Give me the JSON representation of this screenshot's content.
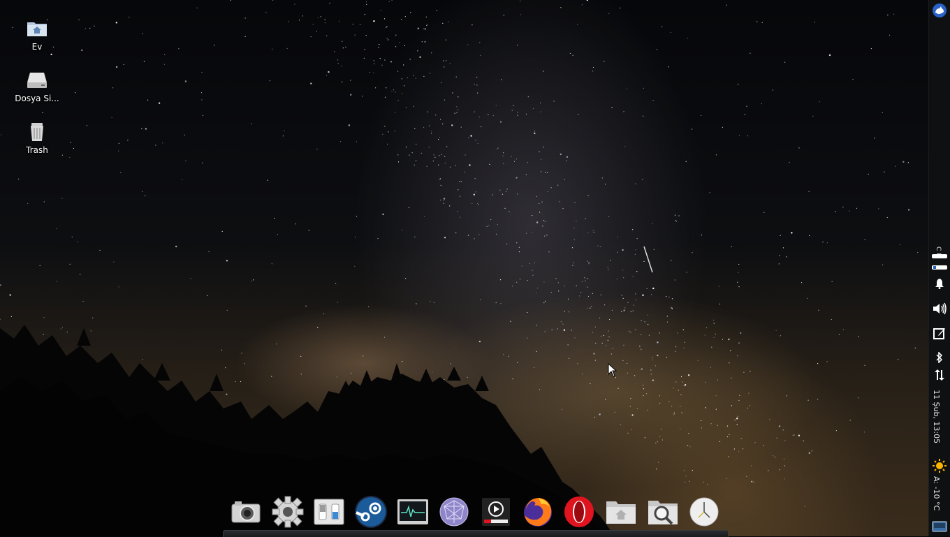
{
  "desktop": {
    "icons": [
      {
        "label": "Ev",
        "icon": "home-folder-icon"
      },
      {
        "label": "Dosya Si...",
        "icon": "drive-icon"
      },
      {
        "label": "Trash",
        "icon": "trash-icon"
      }
    ]
  },
  "panel": {
    "clock": "11 Şub, 13:05",
    "weather": "A: -10 °C",
    "keyboard_layout": "C R"
  },
  "dock": {
    "items": [
      {
        "name": "camera-app",
        "icon": "camera-icon"
      },
      {
        "name": "settings-app",
        "icon": "gear-icon"
      },
      {
        "name": "switches-app",
        "icon": "toggle-icon"
      },
      {
        "name": "steam-app",
        "icon": "steam-icon"
      },
      {
        "name": "system-monitor-app",
        "icon": "monitor-icon"
      },
      {
        "name": "web-browser-app",
        "icon": "globe-icon"
      },
      {
        "name": "media-player-app",
        "icon": "play-icon"
      },
      {
        "name": "firefox-app",
        "icon": "firefox-icon"
      },
      {
        "name": "opera-app",
        "icon": "opera-icon"
      },
      {
        "name": "home-files-app",
        "icon": "home-folder-icon"
      },
      {
        "name": "search-app",
        "icon": "search-icon"
      },
      {
        "name": "clock-app",
        "icon": "clock-icon"
      }
    ]
  },
  "colors": {
    "panel_bg": "#0f1012",
    "opera_red": "#e0141e",
    "firefox_orange": "#ff7a18",
    "steam_blue": "#1b5b9a"
  }
}
